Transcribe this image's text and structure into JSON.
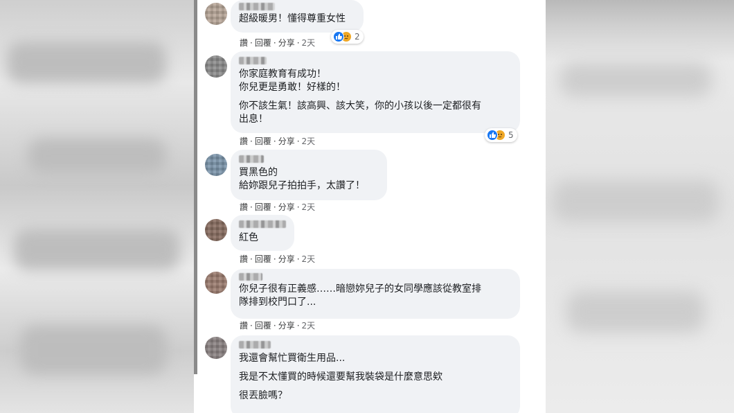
{
  "comments": [
    {
      "lines": [
        "超級暖男！懂得尊重女性"
      ],
      "actions": {
        "like": "讚",
        "reply": "回覆",
        "share": "分享",
        "time": "2天",
        "sep": "·"
      },
      "reactions": {
        "count": "2",
        "icons": [
          "like-icon",
          "love-icon"
        ]
      }
    },
    {
      "lines": [
        "你家庭教育有成功！",
        "你兒更是勇敢！好樣的！"
      ],
      "lines2": [
        "你不該生氣！該高興、該大笑，你的小孩以後一定都很有",
        "出息！"
      ],
      "actions": {
        "like": "讚",
        "reply": "回覆",
        "share": "分享",
        "time": "2天",
        "sep": "·"
      },
      "reactions": {
        "count": "5",
        "icons": [
          "like-icon",
          "love-icon"
        ]
      }
    },
    {
      "lines": [
        "買黑色的",
        "給妳跟兒子拍拍手，太讚了！"
      ],
      "actions": {
        "like": "讚",
        "reply": "回覆",
        "share": "分享",
        "time": "2天",
        "sep": "·"
      }
    },
    {
      "lines": [
        "紅色"
      ],
      "actions": {
        "like": "讚",
        "reply": "回覆",
        "share": "分享",
        "time": "2天",
        "sep": "·"
      }
    },
    {
      "lines": [
        "你兒子很有正義感……暗戀妳兒子的女同學應該從教室排",
        "隊排到校門口了..."
      ],
      "actions": {
        "like": "讚",
        "reply": "回覆",
        "share": "分享",
        "time": "2天",
        "sep": "·"
      }
    },
    {
      "lines": [
        "我還會幫忙買衛生用品..."
      ],
      "lines2": [
        "我是不太懂買的時候還要幫我裝袋是什麼意思欸"
      ],
      "lines3": [
        "很丟臉嗎？"
      ]
    }
  ],
  "colors": {
    "bubble_bg": "#f0f2f5",
    "text": "#1c1e21",
    "like_blue": "#1877f2",
    "love_orange": "#f0a826"
  }
}
